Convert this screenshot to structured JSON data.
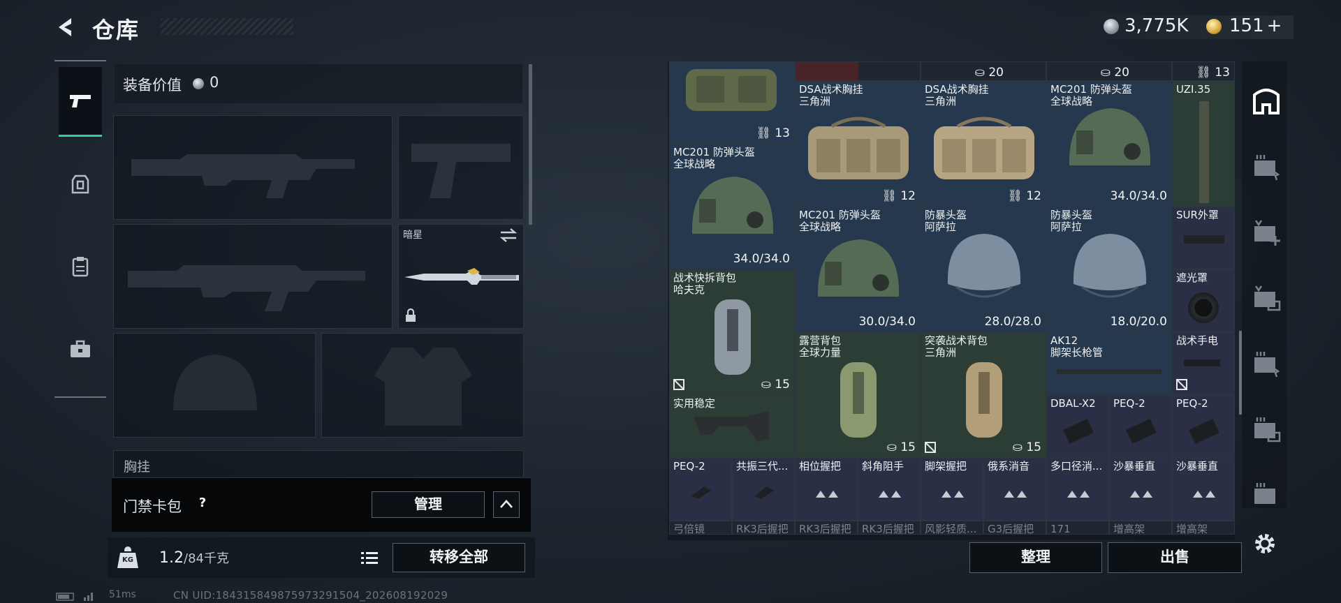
{
  "header": {
    "title": "仓库",
    "currency_silver": "3,775K",
    "currency_gold": "151",
    "add_label": "+"
  },
  "loadout": {
    "value_label": "装备价值",
    "value": "0",
    "knife_slot_name": "暗星",
    "chest_label_partial": "胸挂",
    "cardpack_label": "门禁卡包",
    "help_label": "?",
    "manage_label": "管理",
    "weight_value": "1.2",
    "weight_capacity": "/84千克",
    "weight_icon_text": "KG",
    "transfer_all_label": "转移全部"
  },
  "status": {
    "ping": "51ms",
    "uid": "CN UID:184315849875973291504_202608192029"
  },
  "storage": {
    "top_counts": [
      "20",
      "20",
      "13"
    ],
    "items": [
      {
        "id": "bag-top",
        "count": "13",
        "color": "blue"
      },
      {
        "id": "dsa1",
        "name": "DSA战术胸挂\n三角洲",
        "count": "12",
        "color": "blue"
      },
      {
        "id": "dsa2",
        "name": "DSA战术胸挂\n三角洲",
        "count": "12",
        "color": "blue"
      },
      {
        "id": "mc201-a",
        "name": "MC201 防弹头盔\n全球战略",
        "dur": "34.0/34.0",
        "color": "blue"
      },
      {
        "id": "uzi",
        "name": "UZI.35",
        "color": "green"
      },
      {
        "id": "mc201-b",
        "name": "MC201 防弹头盔\n全球战略",
        "dur": "34.0/34.0",
        "color": "blue"
      },
      {
        "id": "mc201-c",
        "name": "MC201 防弹头盔\n全球战略",
        "dur": "30.0/34.0",
        "color": "blue"
      },
      {
        "id": "riot1",
        "name": "防暴头盔\n阿萨拉",
        "dur": "28.0/28.0",
        "color": "blue"
      },
      {
        "id": "riot2",
        "name": "防暴头盔\n阿萨拉",
        "dur": "18.0/20.0",
        "color": "blue"
      },
      {
        "id": "sur",
        "name": "SUR外罩",
        "color": "purple"
      },
      {
        "id": "hood",
        "name": "遮光罩",
        "color": "purple"
      },
      {
        "id": "hafk",
        "name": "战术快拆背包\n哈夫克",
        "count": "15",
        "color": "green"
      },
      {
        "id": "camp",
        "name": "露营背包\n全球力量",
        "count": "15",
        "color": "green"
      },
      {
        "id": "assault",
        "name": "突袭战术背包\n三角洲",
        "count": "15",
        "color": "green"
      },
      {
        "id": "ak12",
        "name": "AK12\n脚架长枪管",
        "color": "blue"
      },
      {
        "id": "flash",
        "name": "战术手电",
        "color": "purple"
      },
      {
        "id": "stock",
        "name": "实用稳定",
        "color": "green"
      },
      {
        "id": "dbal",
        "name": "DBAL-X2",
        "color": "purple"
      },
      {
        "id": "peq1",
        "name": "PEQ-2",
        "color": "purple"
      },
      {
        "id": "peq2",
        "name": "PEQ-2",
        "color": "purple"
      }
    ],
    "small_row": [
      "PEQ-2",
      "共振三代...",
      "相位握把",
      "斜角阻手",
      "脚架握把",
      "俄系消音",
      "多口径消...",
      "沙暴垂直",
      "沙暴垂直"
    ],
    "ghost_row": [
      "弓倍镜",
      "RK3后握把",
      "RK3后握把",
      "RK3后握把",
      "风影轻质...",
      "G3后握把",
      "171",
      "增高架",
      "增高架"
    ],
    "sort_label": "整理",
    "sell_label": "出售"
  },
  "colors": {
    "accent": "#2fd0a0",
    "blue_cell": "#26384d",
    "green_cell": "#2b3d34",
    "purple_cell": "#2b2f45"
  }
}
